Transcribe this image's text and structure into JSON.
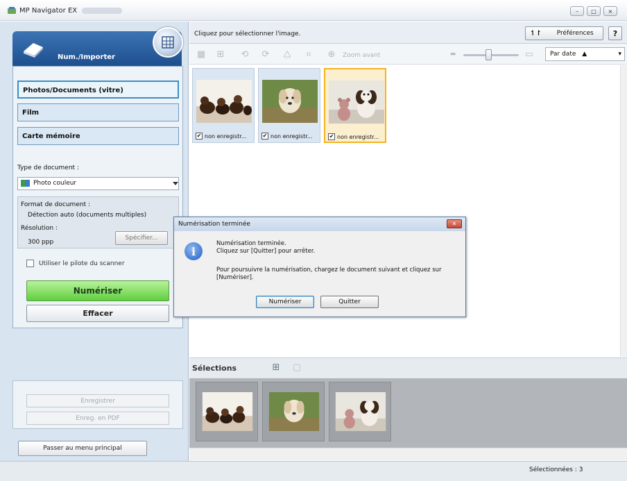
{
  "window": {
    "title": "MP Navigator EX",
    "buttons": {
      "minimize": "–",
      "maximize": "□",
      "close": "×"
    }
  },
  "left_panel": {
    "header_title": "Num./Importer",
    "sources": [
      "Photos/Documents (vitre)",
      "Film",
      "Carte mémoire"
    ],
    "selected_source": 0,
    "doc_type_label": "Type de document :",
    "doc_type_value": "Photo couleur",
    "format_label": "Format de document :",
    "format_value": "Détection auto (documents multiples)",
    "resolution_label": "Résolution :",
    "resolution_value": "300 ppp",
    "specify_button": "Spécifier...",
    "scanner_driver_label": "Utiliser le pilote du scanner",
    "scanner_driver_checked": false,
    "scan_button": "Numériser",
    "clear_button": "Effacer",
    "save_button": "Enregistrer",
    "save_pdf_button": "Enreg. en PDF",
    "main_menu_button": "Passer au menu principal"
  },
  "right_panel": {
    "hint": "Cliquez pour sélectionner l'image.",
    "preferences_button": "Préférences",
    "help_button": "?",
    "zoom_label": "Zoom avant",
    "sort_value": "Par date",
    "thumbnails": [
      {
        "caption": "non enregistr...",
        "checked": true,
        "image": "dogs-on-couch"
      },
      {
        "caption": "non enregistr...",
        "checked": true,
        "image": "golden-retriever"
      },
      {
        "caption": "non enregistr...",
        "checked": true,
        "image": "dog-and-teddy-bear",
        "active": true
      }
    ],
    "selections_title": "Sélections"
  },
  "status": {
    "selected_count": "Sélectionnées : 3"
  },
  "dialog": {
    "title": "Numérisation terminée",
    "line1": "Numérisation terminée.",
    "line2": "Cliquez sur [Quitter] pour arrêter.",
    "line3": "Pour poursuivre la numérisation, chargez le document suivant et cliquez sur [Numériser].",
    "scan_button": "Numériser",
    "quit_button": "Quitter"
  },
  "colors": {
    "accent": "#1e4f8f",
    "scan_green": "#5fcf3f",
    "selection_border": "#f2b31e"
  }
}
